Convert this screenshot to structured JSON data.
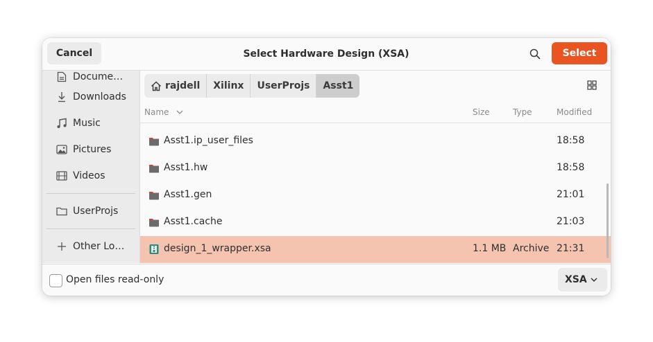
{
  "header": {
    "cancel_label": "Cancel",
    "title": "Select Hardware Design (XSA)",
    "select_label": "Select",
    "search_icon": "search-icon"
  },
  "sidebar": {
    "items": [
      {
        "label": "Docume…",
        "icon": "document-icon"
      },
      {
        "label": "Downloads",
        "icon": "download-icon"
      },
      {
        "label": "Music",
        "icon": "music-icon"
      },
      {
        "label": "Pictures",
        "icon": "picture-icon"
      },
      {
        "label": "Videos",
        "icon": "video-icon"
      },
      {
        "label": "UserProjs",
        "icon": "folder-icon"
      },
      {
        "label": "Other Lo…",
        "icon": "plus-icon"
      }
    ]
  },
  "pathbar": {
    "crumbs": [
      "rajdell",
      "Xilinx",
      "UserProjs",
      "Asst1"
    ]
  },
  "columns": {
    "name": "Name",
    "size": "Size",
    "type": "Type",
    "modified": "Modified"
  },
  "files": [
    {
      "name": "Asst1.ip_user_files",
      "size": "",
      "type": "",
      "modified": "18:58",
      "kind": "folder"
    },
    {
      "name": "Asst1.hw",
      "size": "",
      "type": "",
      "modified": "18:58",
      "kind": "folder"
    },
    {
      "name": "Asst1.gen",
      "size": "",
      "type": "",
      "modified": "21:01",
      "kind": "folder"
    },
    {
      "name": "Asst1.cache",
      "size": "",
      "type": "",
      "modified": "21:03",
      "kind": "folder"
    },
    {
      "name": "design_1_wrapper.xsa",
      "size": "1.1 MB",
      "type": "Archive",
      "modified": "21:31",
      "kind": "archive",
      "selected": true
    }
  ],
  "footer": {
    "readonly_label": "Open files read-only",
    "filter_value": "XSA"
  },
  "colors": {
    "accent": "#e95420",
    "selection": "#f5c4b1",
    "folder": "#6b6b6b",
    "folder_tab": "#c8463b"
  }
}
